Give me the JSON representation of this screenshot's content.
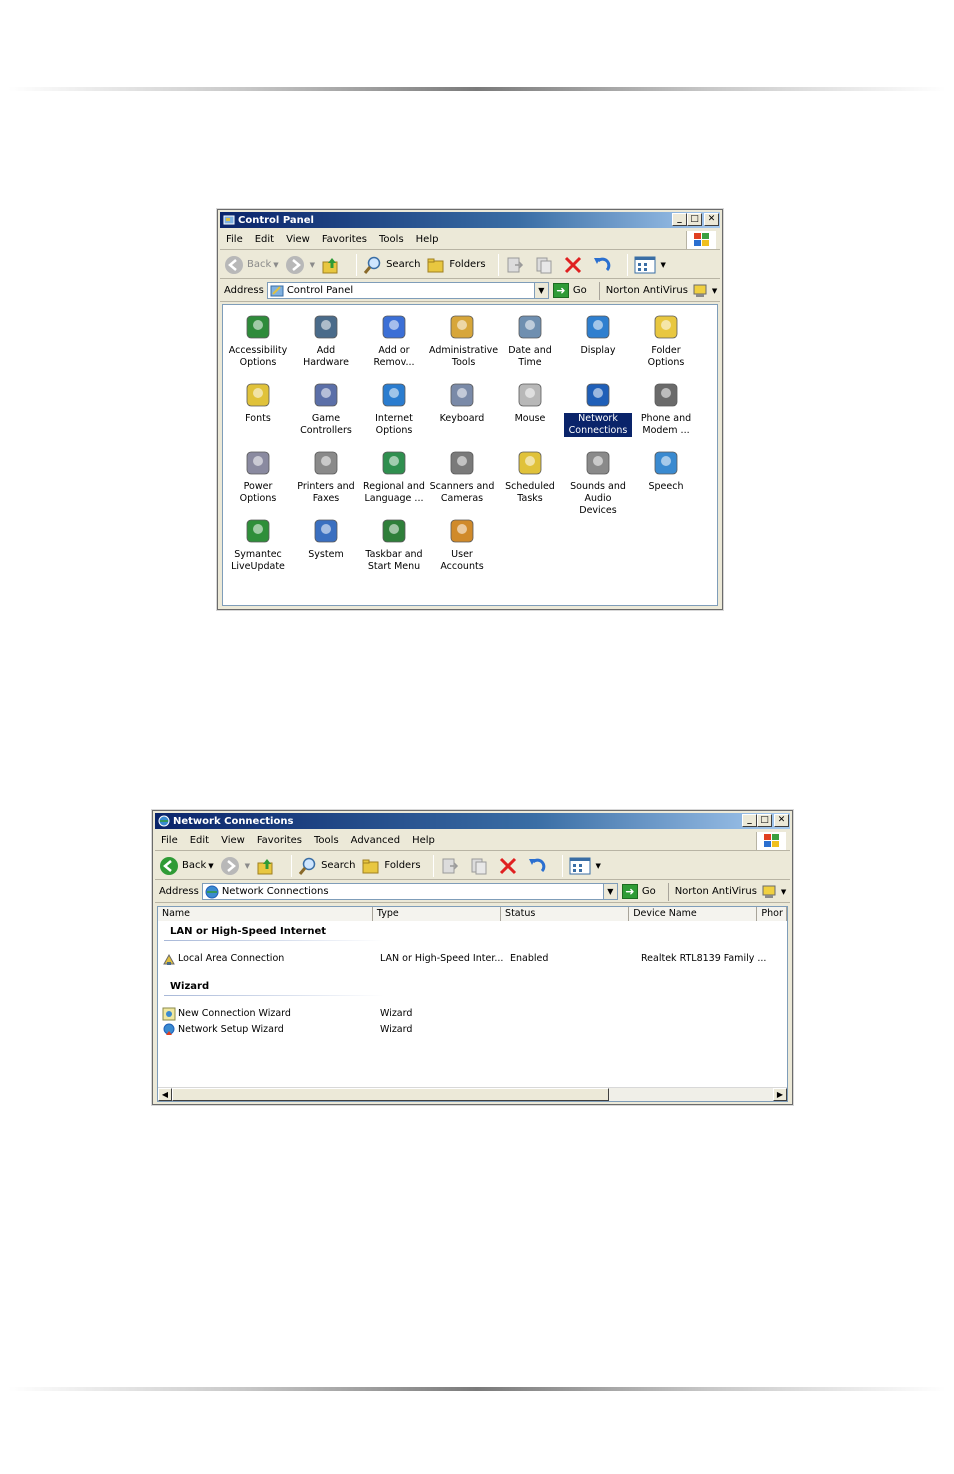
{
  "control_panel": {
    "title": "Control Panel",
    "menu": [
      "File",
      "Edit",
      "View",
      "Favorites",
      "Tools",
      "Help"
    ],
    "toolbar": {
      "back": "Back",
      "search": "Search",
      "folders": "Folders"
    },
    "address": {
      "label": "Address",
      "value": "Control Panel",
      "go": "Go",
      "norton": "Norton AntiVirus"
    },
    "icons": [
      {
        "label": "Accessibility Options",
        "icon": "accessibility-icon",
        "color": "#2e8b3a"
      },
      {
        "label": "Add Hardware",
        "icon": "add-hardware-icon",
        "color": "#4a6b8a"
      },
      {
        "label": "Add or Remov...",
        "icon": "add-remove-programs-icon",
        "color": "#3b6fd6"
      },
      {
        "label": "Administrative Tools",
        "icon": "administrative-tools-icon",
        "color": "#d7a63a"
      },
      {
        "label": "Date and Time",
        "icon": "date-time-icon",
        "color": "#6f8fb0"
      },
      {
        "label": "Display",
        "icon": "display-icon",
        "color": "#2f7fcf"
      },
      {
        "label": "Folder Options",
        "icon": "folder-options-icon",
        "color": "#e8c740"
      },
      {
        "label": "Fonts",
        "icon": "fonts-icon",
        "color": "#e0c23a"
      },
      {
        "label": "Game Controllers",
        "icon": "game-controllers-icon",
        "color": "#5b6fa8"
      },
      {
        "label": "Internet Options",
        "icon": "internet-options-icon",
        "color": "#2a7ccf"
      },
      {
        "label": "Keyboard",
        "icon": "keyboard-icon",
        "color": "#7a8aa8"
      },
      {
        "label": "Mouse",
        "icon": "mouse-icon",
        "color": "#b8b8b8"
      },
      {
        "label": "Network Connections",
        "icon": "network-connections-icon",
        "color": "#1f5fb8",
        "selected": true
      },
      {
        "label": "Phone and Modem ...",
        "icon": "phone-modem-icon",
        "color": "#6a6a6a"
      },
      {
        "label": "Power Options",
        "icon": "power-options-icon",
        "color": "#8a8aa0"
      },
      {
        "label": "Printers and Faxes",
        "icon": "printers-faxes-icon",
        "color": "#8a8a8a"
      },
      {
        "label": "Regional and Language ...",
        "icon": "regional-language-icon",
        "color": "#2f8f4f"
      },
      {
        "label": "Scanners and Cameras",
        "icon": "scanners-cameras-icon",
        "color": "#7a7a7a"
      },
      {
        "label": "Scheduled Tasks",
        "icon": "scheduled-tasks-icon",
        "color": "#e0c23a"
      },
      {
        "label": "Sounds and Audio Devices",
        "icon": "sounds-audio-icon",
        "color": "#8a8a8a"
      },
      {
        "label": "Speech",
        "icon": "speech-icon",
        "color": "#3a8ad0"
      },
      {
        "label": "Symantec LiveUpdate",
        "icon": "symantec-liveupdate-icon",
        "color": "#2f8f3a"
      },
      {
        "label": "System",
        "icon": "system-icon",
        "color": "#3a6fc0"
      },
      {
        "label": "Taskbar and Start Menu",
        "icon": "taskbar-start-menu-icon",
        "color": "#2f7f3a"
      },
      {
        "label": "User Accounts",
        "icon": "user-accounts-icon",
        "color": "#d08a2a"
      }
    ]
  },
  "network_connections": {
    "title": "Network Connections",
    "menu": [
      "File",
      "Edit",
      "View",
      "Favorites",
      "Tools",
      "Advanced",
      "Help"
    ],
    "toolbar": {
      "back": "Back",
      "search": "Search",
      "folders": "Folders"
    },
    "address": {
      "label": "Address",
      "value": "Network Connections",
      "go": "Go",
      "norton": "Norton AntiVirus"
    },
    "columns": [
      "Name",
      "Type",
      "Status",
      "Device Name",
      "Phor"
    ],
    "groups": [
      {
        "title": "LAN or High-Speed Internet",
        "rows": [
          {
            "name": "Local Area Connection",
            "type": "LAN or High-Speed Inter...",
            "status": "Enabled",
            "device": "Realtek RTL8139 Family ...",
            "icon": "lan-connection-icon"
          }
        ]
      },
      {
        "title": "Wizard",
        "rows": [
          {
            "name": "New Connection Wizard",
            "type": "Wizard",
            "status": "",
            "device": "",
            "icon": "new-connection-wizard-icon"
          },
          {
            "name": "Network Setup Wizard",
            "type": "Wizard",
            "status": "",
            "device": "",
            "icon": "network-setup-wizard-icon"
          }
        ]
      }
    ]
  }
}
